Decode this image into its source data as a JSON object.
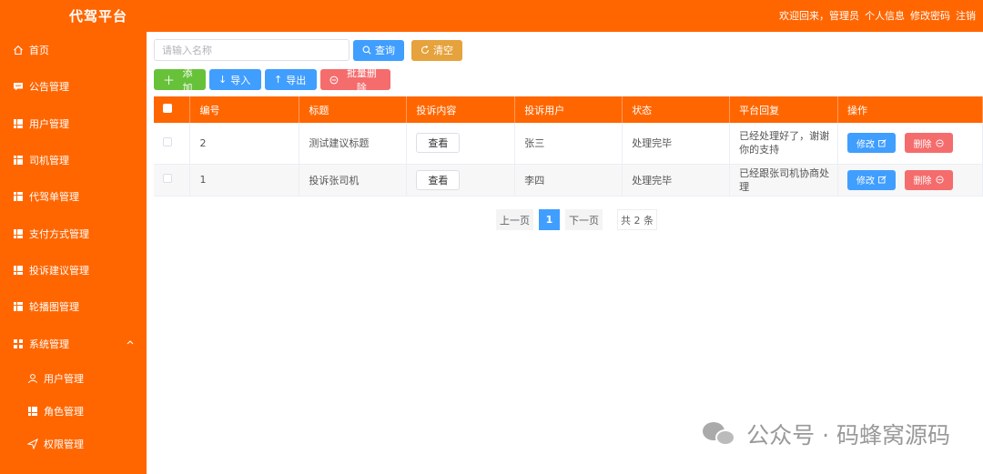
{
  "header": {
    "brand": "代驾平台",
    "welcome": "欢迎回来，管理员",
    "profile": "个人信息",
    "change_password": "修改密码",
    "logout": "注销"
  },
  "sidebar": {
    "items": [
      {
        "label": "首页",
        "icon": "home-icon"
      },
      {
        "label": "公告管理",
        "icon": "message-icon"
      },
      {
        "label": "用户管理",
        "icon": "grid-icon"
      },
      {
        "label": "司机管理",
        "icon": "grid-icon"
      },
      {
        "label": "代驾单管理",
        "icon": "grid-icon"
      },
      {
        "label": "支付方式管理",
        "icon": "grid-icon"
      },
      {
        "label": "投诉建议管理",
        "icon": "grid-icon"
      },
      {
        "label": "轮播图管理",
        "icon": "grid-icon"
      },
      {
        "label": "系统管理",
        "icon": "menu-icon",
        "expanded": true
      }
    ],
    "subitems": [
      {
        "label": "用户管理",
        "icon": "user-icon"
      },
      {
        "label": "角色管理",
        "icon": "grid-icon"
      },
      {
        "label": "权限管理",
        "icon": "send-icon"
      }
    ]
  },
  "search": {
    "placeholder": "请输入名称",
    "query_label": "查询",
    "clear_label": "清空"
  },
  "toolbar": {
    "add_label": "添加",
    "import_label": "导入",
    "export_label": "导出",
    "batch_delete_label": "批量删除"
  },
  "table": {
    "columns": [
      "编号",
      "标题",
      "投诉内容",
      "投诉用户",
      "状态",
      "平台回复",
      "操作"
    ],
    "view_label": "查看",
    "edit_label": "修改",
    "delete_label": "删除",
    "rows": [
      {
        "id": "2",
        "title": "测试建议标题",
        "user": "张三",
        "status": "处理完毕",
        "reply": "已经处理好了，谢谢你的支持"
      },
      {
        "id": "1",
        "title": "投诉张司机",
        "user": "李四",
        "status": "处理完毕",
        "reply": "已经跟张司机协商处理"
      }
    ]
  },
  "pagination": {
    "prev": "上一页",
    "current": "1",
    "next": "下一页",
    "total": "共 2 条"
  },
  "watermark": {
    "text": "公众号 · 码蜂窝源码"
  },
  "colors": {
    "brand": "#ff6600",
    "primary": "#409eff",
    "success": "#67c23a",
    "warning": "#e6a23c",
    "danger": "#f56c6c"
  }
}
